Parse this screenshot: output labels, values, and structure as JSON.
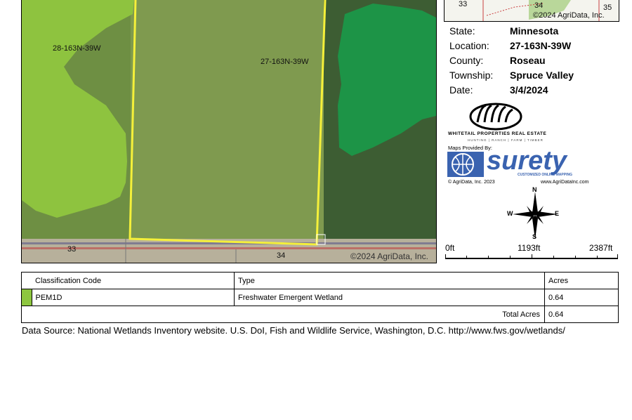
{
  "map": {
    "section_labels": [
      "28-163N-39W",
      "27-163N-39W"
    ],
    "road_labels": [
      "33",
      "34"
    ],
    "copyright": "©2024 AgriData, Inc."
  },
  "inset": {
    "labels": [
      "33",
      "34",
      "35"
    ],
    "copyright": "©2024 AgriData, Inc."
  },
  "info": [
    {
      "label": "State:",
      "value": "Minnesota"
    },
    {
      "label": "Location:",
      "value": "27-163N-39W"
    },
    {
      "label": "County:",
      "value": "Roseau"
    },
    {
      "label": "Township:",
      "value": "Spruce Valley"
    },
    {
      "label": "Date:",
      "value": "3/4/2024"
    }
  ],
  "branding": {
    "company": "WHITETAIL PROPERTIES REAL ESTATE",
    "tagline": "HUNTING | RANCH | FARM | TIMBER",
    "maps_provided_by": "Maps Provided By:",
    "surety_name": "surety",
    "surety_tagline": "CUSTOMIZED ONLINE MAPPING",
    "agridata_copyright": "© AgriData, Inc. 2023",
    "agridata_url": "www.AgriDataInc.com"
  },
  "compass": {
    "n": "N",
    "s": "S",
    "e": "E",
    "w": "W"
  },
  "scale": {
    "labels": [
      "0ft",
      "1193ft",
      "2387ft"
    ]
  },
  "legend": {
    "headers": [
      "Classification Code",
      "Type",
      "Acres"
    ],
    "rows": [
      {
        "color": "#8dc63f",
        "code": "PEM1D",
        "type": "Freshwater Emergent Wetland",
        "acres": "0.64"
      }
    ],
    "total_label": "Total Acres",
    "total_value": "0.64"
  },
  "data_source": "Data Source: National Wetlands Inventory website. U.S. DoI, Fish and Wildlife Service, Washington, D.C. http://www.fws.gov/wetlands/"
}
